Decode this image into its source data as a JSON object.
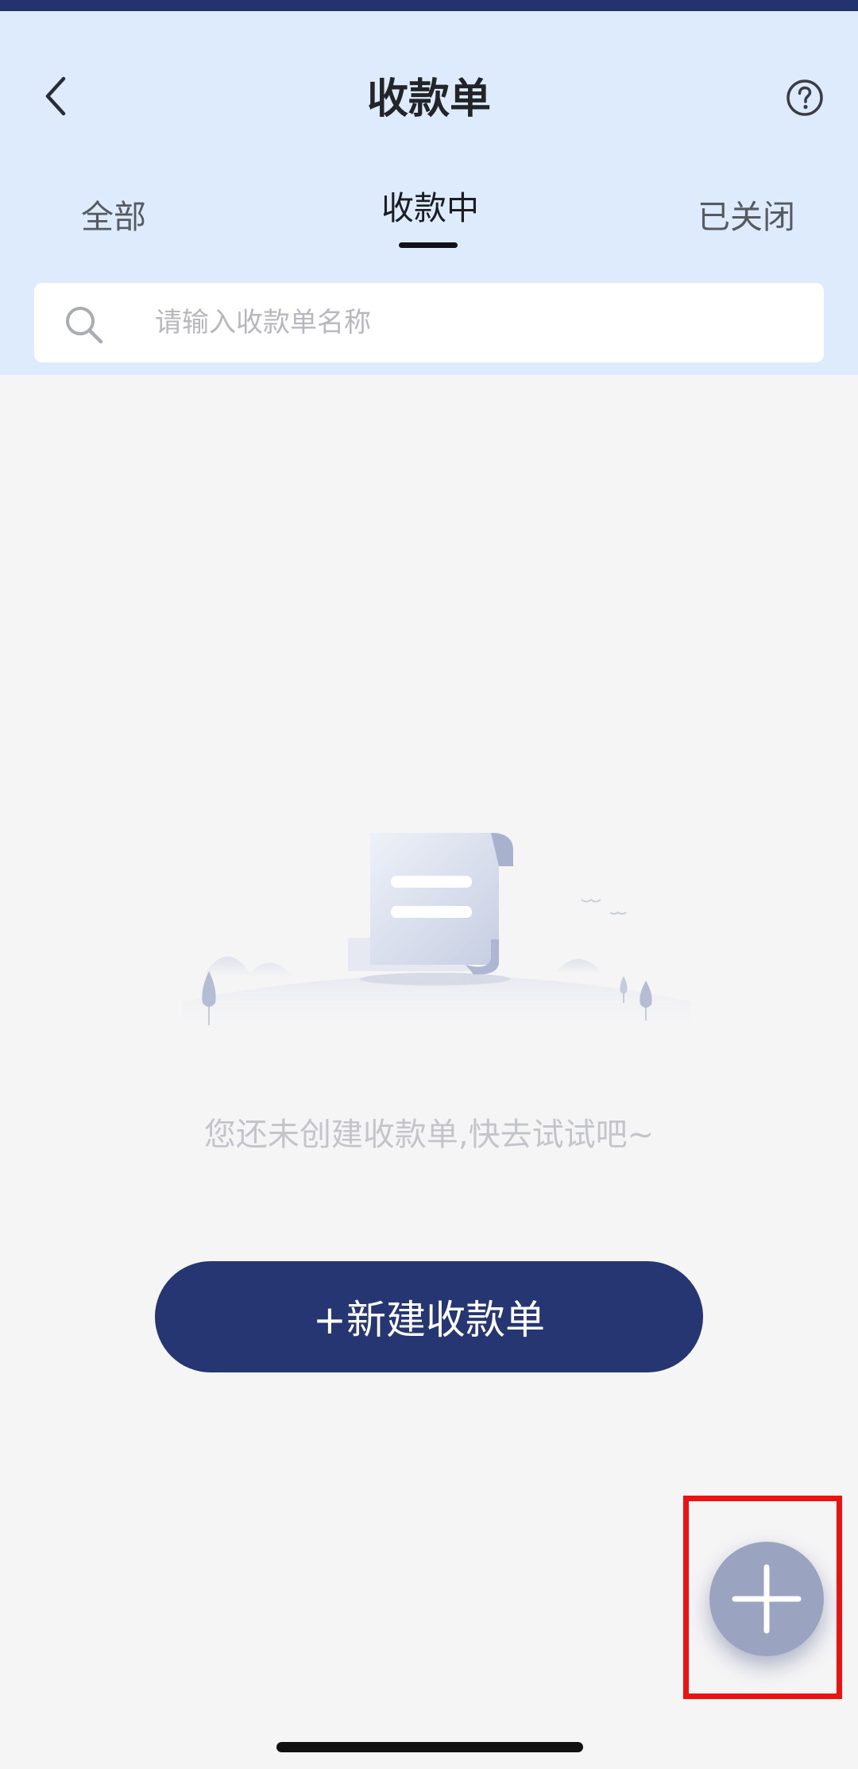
{
  "header": {
    "title": "收款单",
    "back_icon": "chevron-left-icon",
    "help_icon": "question-circle-icon",
    "accent_color": "#263673",
    "background_color": "#deebfc"
  },
  "tabs": [
    {
      "label": "全部",
      "active": false
    },
    {
      "label": "收款中",
      "active": true
    },
    {
      "label": "已关闭",
      "active": false
    }
  ],
  "search": {
    "placeholder": "请输入收款单名称",
    "icon": "search-icon"
  },
  "empty_state": {
    "illustration": "document-scroll-illustration",
    "message": "您还未创建收款单,快去试试吧~"
  },
  "actions": {
    "new_button_label": "+新建收款单",
    "fab_icon": "plus-icon",
    "highlight_color": "#ee1111"
  }
}
